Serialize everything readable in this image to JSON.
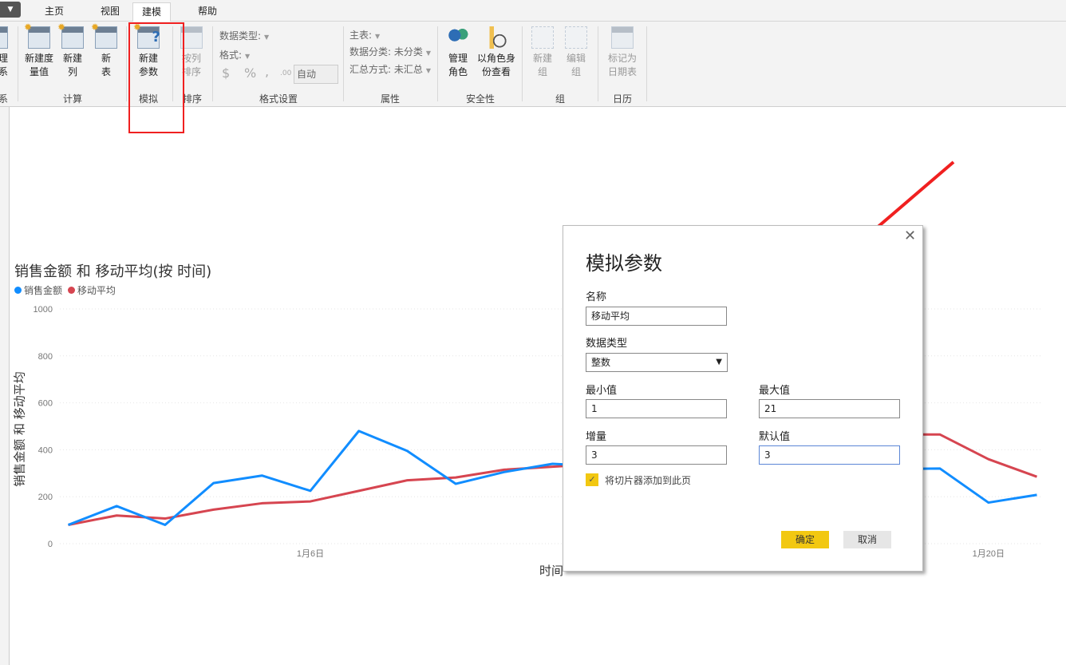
{
  "tabs": {
    "file": "▼",
    "items": [
      "主页",
      "视图",
      "建模",
      "帮助"
    ],
    "active": "建模"
  },
  "ribbon": {
    "partial": {
      "label1": "理",
      "label2": "系",
      "group": "系"
    },
    "calc": {
      "new_measure": [
        "新建度",
        "量值"
      ],
      "new_column": [
        "新建",
        "列"
      ],
      "new_table": [
        "新",
        "表"
      ],
      "group": "计算"
    },
    "whatif": {
      "new_param": [
        "新建",
        "参数"
      ],
      "group": "模拟"
    },
    "sort": {
      "sort_by_col": [
        "按列",
        "排序"
      ],
      "group": "排序"
    },
    "format": {
      "data_type": "数据类型:",
      "format": "格式:",
      "dollar": "$",
      "percent": "%",
      "comma": ",",
      "decimals": ".00",
      "auto": "自动",
      "group": "格式设置"
    },
    "props": {
      "home_table": "主表:",
      "data_category": "数据分类: 未分类",
      "summarize": "汇总方式: 未汇总",
      "group": "属性"
    },
    "security": {
      "manage_roles": [
        "管理",
        "角色"
      ],
      "view_as": [
        "以角色身",
        "份查看"
      ],
      "group": "安全性"
    },
    "groups": {
      "new_group": [
        "新建",
        "组"
      ],
      "edit_group": [
        "编辑",
        "组"
      ],
      "group": "组"
    },
    "calendar": {
      "mark_date": [
        "标记为",
        "日期表"
      ],
      "group": "日历"
    }
  },
  "chart_data": {
    "type": "line",
    "title": "销售金额 和 移动平均(按 时间)",
    "xlabel": "时间",
    "ylabel": "销售金额 和 移动平均",
    "ylim": [
      0,
      1000
    ],
    "yticks": [
      0,
      200,
      400,
      600,
      800,
      1000
    ],
    "xticks": [
      {
        "day": 6,
        "label": "1月6日"
      },
      {
        "day": 20,
        "label": "1月20日"
      }
    ],
    "x": [
      1,
      2,
      3,
      4,
      5,
      6,
      7,
      8,
      9,
      10,
      11,
      12,
      13,
      14,
      15,
      16,
      17,
      18,
      19,
      20,
      21
    ],
    "legend_position": "top-left",
    "series": [
      {
        "name": "销售金额",
        "color": "#118dff",
        "values": [
          80,
          160,
          80,
          258,
          290,
          225,
          480,
          395,
          255,
          305,
          340,
          330,
          360,
          380,
          420,
          380,
          340,
          318,
          320,
          175,
          208
        ]
      },
      {
        "name": "移动平均",
        "color": "#d64550",
        "values": [
          80,
          120,
          107,
          145,
          172,
          180,
          225,
          270,
          282,
          315,
          328,
          340,
          360,
          390,
          420,
          440,
          455,
          465,
          465,
          360,
          285
        ]
      }
    ]
  },
  "dialog": {
    "title": "模拟参数",
    "close": "✕",
    "name_label": "名称",
    "name_value": "移动平均",
    "type_label": "数据类型",
    "type_value": "整数",
    "min_label": "最小值",
    "min_value": "1",
    "max_label": "最大值",
    "max_value": "21",
    "inc_label": "增量",
    "inc_value": "3",
    "default_label": "默认值",
    "default_value": "3",
    "slicer_label": "将切片器添加到此页",
    "slicer_checked": true,
    "ok": "确定",
    "cancel": "取消"
  },
  "colors": {
    "accent": "#f2c811",
    "annotation": "#f02020"
  }
}
